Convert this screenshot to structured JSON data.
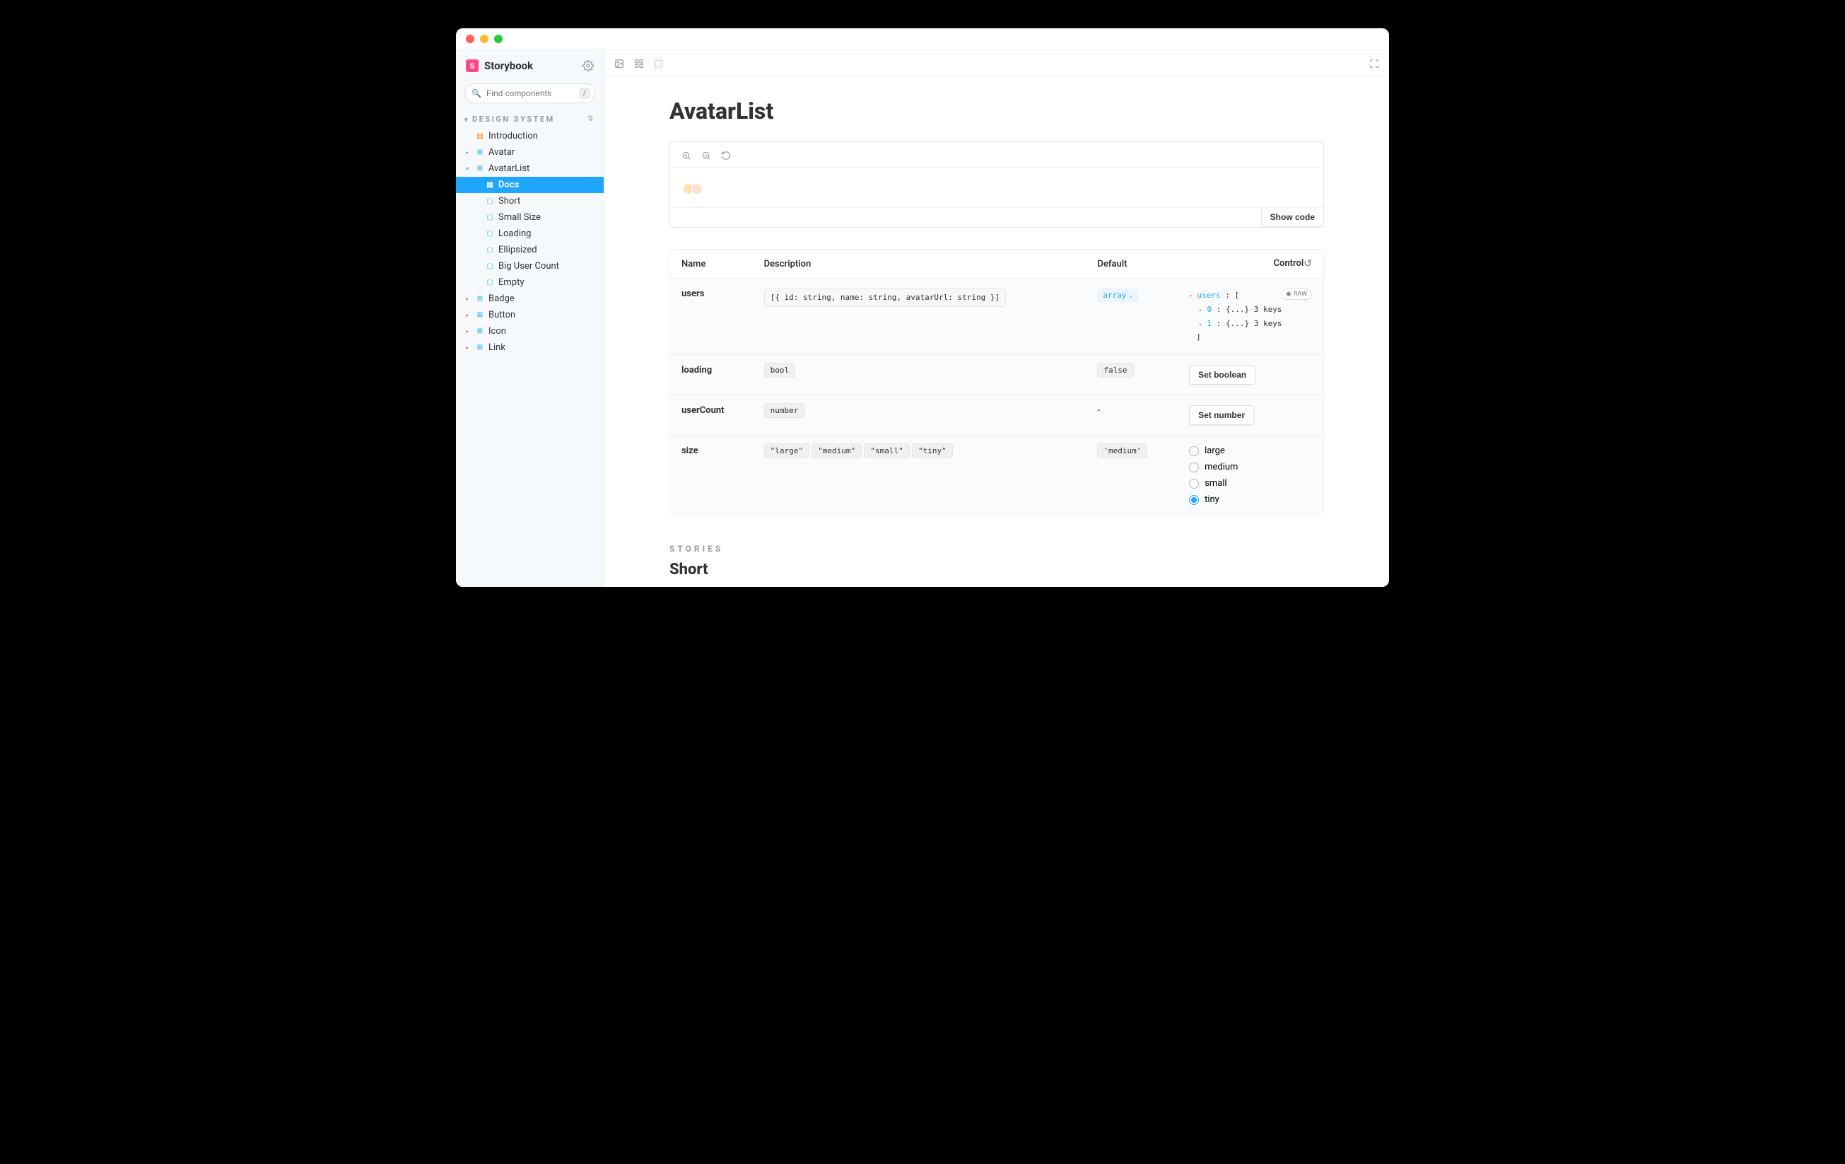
{
  "brand": "Storybook",
  "search_placeholder": "Find components",
  "search_shortcut": "/",
  "section_label": "DESIGN SYSTEM",
  "nav": {
    "introduction": "Introduction",
    "avatar": "Avatar",
    "avatarlist": "AvatarList",
    "docs": "Docs",
    "short": "Short",
    "smallsize": "Small Size",
    "loading": "Loading",
    "ellipsized": "Ellipsized",
    "bigusercount": "Big User Count",
    "empty": "Empty",
    "badge": "Badge",
    "button": "Button",
    "icon": "Icon",
    "link": "Link"
  },
  "page": {
    "title": "AvatarList",
    "show_code": "Show code",
    "stories_label": "STORIES",
    "story_title": "Short"
  },
  "table": {
    "headers": {
      "name": "Name",
      "description": "Description",
      "default": "Default",
      "control": "Control"
    },
    "raw_label": "RAW",
    "rows": {
      "users": {
        "name": "users",
        "desc": "[{ id: string, name: string, avatarUrl: string }]",
        "type": "array",
        "tree_root": "users",
        "tree_item0_key": "0",
        "tree_item0_val": "{...} 3 keys",
        "tree_item1_key": "1",
        "tree_item1_val": "{...} 3 keys"
      },
      "loading": {
        "name": "loading",
        "desc": "bool",
        "default": "false",
        "control": "Set boolean"
      },
      "usercount": {
        "name": "userCount",
        "desc": "number",
        "default": "-",
        "control": "Set number"
      },
      "size": {
        "name": "size",
        "opt_large": "\"large\"",
        "opt_medium": "\"medium\"",
        "opt_small": "\"small\"",
        "opt_tiny": "\"tiny\"",
        "default": "'medium'",
        "radio_large": "large",
        "radio_medium": "medium",
        "radio_small": "small",
        "radio_tiny": "tiny"
      }
    }
  }
}
